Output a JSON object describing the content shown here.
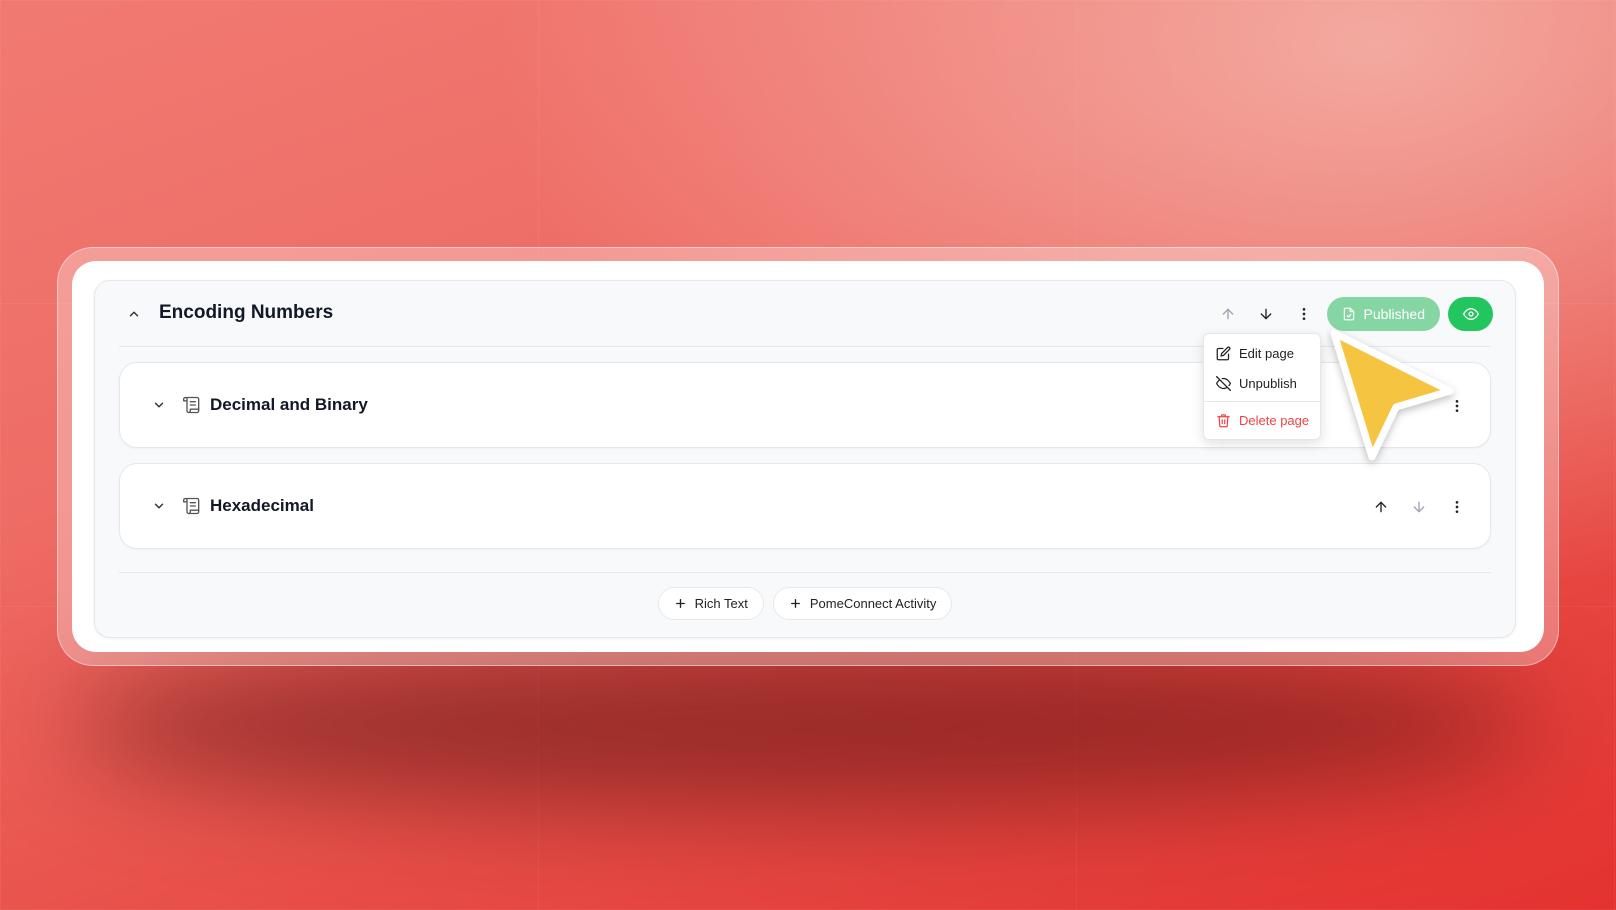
{
  "section": {
    "title": "Encoding Numbers",
    "status_label": "Published"
  },
  "pages": [
    {
      "title": "Decimal and Binary"
    },
    {
      "title": "Hexadecimal"
    }
  ],
  "add_buttons": {
    "rich_text": "Rich Text",
    "activity": "PomeConnect Activity"
  },
  "menu": {
    "edit": "Edit page",
    "unpublish": "Unpublish",
    "delete": "Delete page"
  },
  "colors": {
    "accent_green": "#22c55e",
    "published_green": "#86d6a4",
    "danger_red": "#ef4444",
    "cursor_yellow": "#f5c542"
  }
}
